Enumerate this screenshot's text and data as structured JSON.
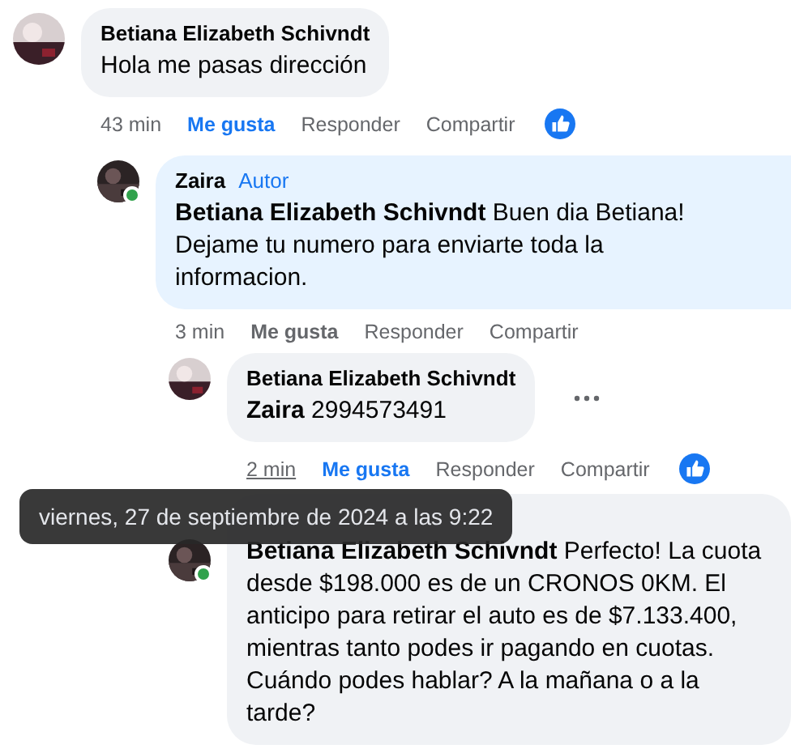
{
  "comments": [
    {
      "author": "Betiana Elizabeth Schivndt",
      "online": false,
      "color": "#f0f2f5",
      "text": "Hola me pasas dirección",
      "time": "43 min",
      "time_hovered": false,
      "liked": true,
      "like_label": "Me gusta",
      "reply_label": "Responder",
      "share_label": "Compartir",
      "reaction": true,
      "more": false,
      "children": [
        {
          "author": "Zaira",
          "badge": "Autor",
          "online": true,
          "color": "#e7f3ff",
          "text": "**Betiana Elizabeth Schivndt** Buen dia Betiana! Dejame tu numero para enviarte toda la informacion.",
          "time": "3 min",
          "time_hovered": false,
          "liked": false,
          "like_label": "Me gusta",
          "reply_label": "Responder",
          "share_label": "Compartir",
          "reaction": false,
          "more": false,
          "children": [
            {
              "author": "Betiana Elizabeth Schivndt",
              "online": false,
              "color": "#f0f2f5",
              "text": "**Zaira** 2994573491",
              "time": "2 min",
              "time_hovered": true,
              "liked": true,
              "like_label": "Me gusta",
              "reply_label": "Responder",
              "share_label": "Compartir",
              "reaction": true,
              "more": true
            },
            {
              "online": true,
              "color": "#f0f2f5",
              "text": "**Betiana Elizabeth Schivndt** Perfecto! La cuota desde $198.000 es de un CRONOS 0KM. El anticipo para retirar el auto es de $7.133.400, mientras tanto podes ir pagando en cuotas. Cuándo podes hablar? A la mañana o a la tarde?"
            }
          ]
        }
      ]
    }
  ],
  "tooltip": {
    "text": "viernes, 27 de septiembre de 2024 a las 9:22"
  }
}
